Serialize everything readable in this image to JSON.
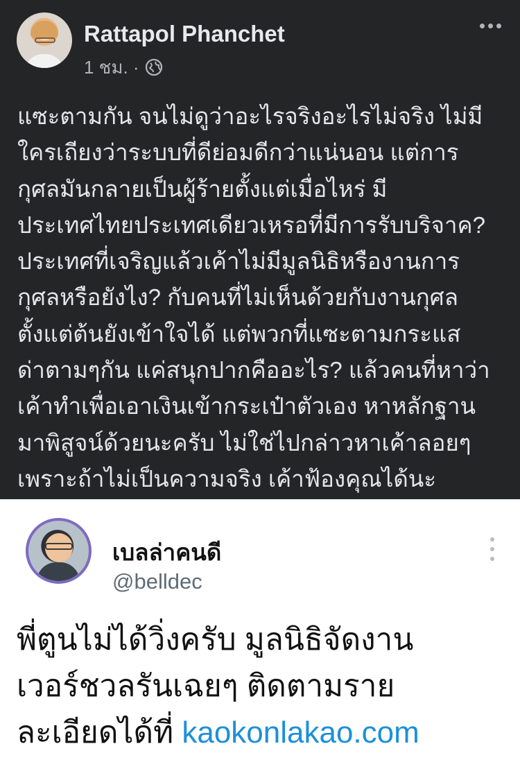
{
  "facebook_post": {
    "author": "Rattapol Phanchet",
    "timestamp": "1 ชม. ·",
    "body_lines": [
      "แซะตามกัน จนไม่ดูว่าอะไรจริงอะไรไม่จริง ไม่มี",
      "ใครเถียงว่าระบบที่ดีย่อมดีกว่าแน่นอน  แต่การ",
      "กุศลมันกลายเป็นผู้ร้ายตั้งแต่เมื่อไหร่ มี",
      "ประเทศไทยประเทศเดียวเหรอที่มีการรับบริจาค?",
      "ประเทศที่เจริญแล้วเค้าไม่มีมูลนิธิหรืองานการ",
      "กุศลหรือยังไง? กับคนที่ไม่เห็นด้วยกับงานกุศล",
      "ตั้งแต่ต้นยังเข้าใจได้ แต่พวกที่แซะตามกระแส",
      "ด่าตามๆกัน แค่สนุกปากคืออะไร? แล้วคนที่หาว่า",
      "เค้าทำเพื่อเอาเงินเข้ากระเป๋าตัวเอง หาหลักฐาน",
      "มาพิสูจน์ด้วยนะครับ ไม่ใช่ไปกล่าวหาเค้าลอยๆ",
      "เพราะถ้าไม่เป็นความจริง เค้าฟ้องคุณได้นะ"
    ],
    "icons": {
      "privacy": "globe-icon",
      "menu": "more-horizontal-icon"
    },
    "colors": {
      "background": "#242526",
      "text": "#e4e6eb",
      "secondary": "#b0b3b8"
    }
  },
  "tweet": {
    "name": "เบลล่าคนดี",
    "handle": "@belldec",
    "body_lines": [
      "พี่ตูนไม่ได้วิ่งครับ มูลนิธิจัดงาน",
      "เวอร์ชวลรันเฉยๆ ติดตามราย"
    ],
    "last_line_prefix": "ละเอียดได้ที่ ",
    "link": "kaokonlakao.com",
    "icons": {
      "menu": "more-vertical-icon"
    },
    "colors": {
      "link": "#1d8fd8",
      "avatar_ring": "#7d6bc1"
    }
  }
}
